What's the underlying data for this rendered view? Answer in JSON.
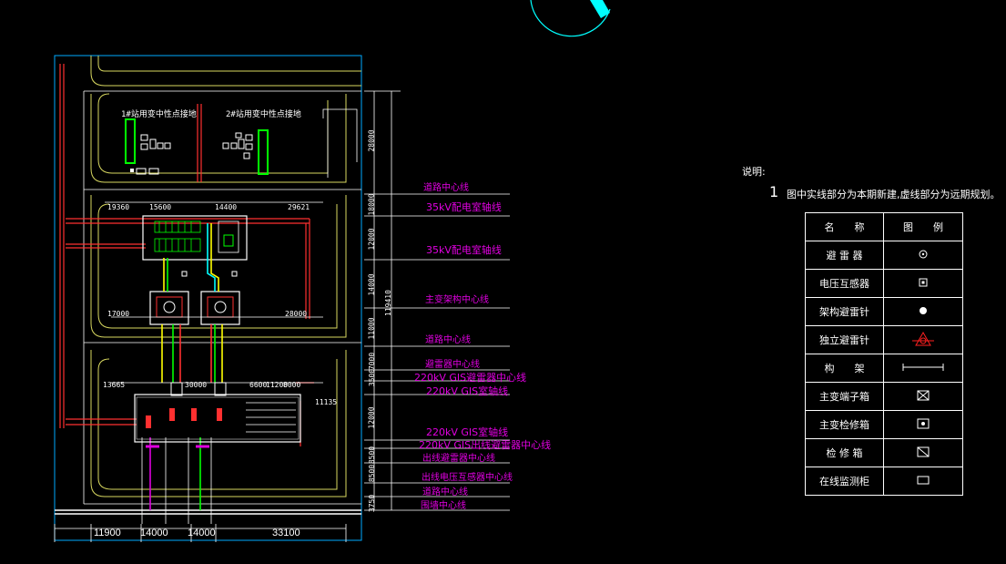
{
  "notes": {
    "title": "说明:",
    "item_number": "1",
    "item_text": "图中实线部分为本期新建,虚线部分为远期规划。"
  },
  "legend": {
    "header_name": "名　　称",
    "header_symbol": "图　　例",
    "rows": [
      {
        "name": "避 雷 器",
        "icon": "circle-dot-icon"
      },
      {
        "name": "电压互感器",
        "icon": "square-dot-icon"
      },
      {
        "name": "架构避雷针",
        "icon": "filled-circle-icon"
      },
      {
        "name": "独立避雷针",
        "icon": "triangle-circle-icon"
      },
      {
        "name": "构　　架",
        "icon": "beam-icon"
      },
      {
        "name": "主变端子箱",
        "icon": "square-x-icon"
      },
      {
        "name": "主变检修箱",
        "icon": "square-dot-filled-icon"
      },
      {
        "name": "检 修 箱",
        "icon": "square-slash-icon"
      },
      {
        "name": "在线监测柜",
        "icon": "rectangle-icon"
      }
    ]
  },
  "centerlines": [
    "道路中心线",
    "35kV配电室轴线",
    "35kV配电室轴线",
    "主变架构中心线",
    "道路中心线",
    "避雷器中心线",
    "220kV GIS避雷器中心线",
    "220kV GIS室轴线",
    "220kV GIS室轴线",
    "220kV GIS出线避雷器中心线",
    "出线避雷器中心线",
    "出线电压互感器中心线",
    "道路中心线",
    "围墙中心线"
  ],
  "bottom_dims": [
    "11900",
    "14000",
    "14000",
    "33100"
  ],
  "right_total_dim": "119410",
  "vertical_dims": [
    "28000",
    "18000",
    "12000",
    "14000",
    "11000",
    "7000",
    "3500",
    "12000",
    "8500",
    "8500",
    "3750"
  ],
  "top_dims": [
    "19360",
    "15600",
    "14400",
    "29621"
  ],
  "mid_dims": [
    "17000",
    "28000",
    "13665",
    "30000",
    "6600",
    "11200",
    "8000",
    "11135"
  ],
  "station_labels": [
    "1#站用变中性点接地",
    "2#站用变中性点接地"
  ],
  "colors": {
    "background": "#000000",
    "boundary": "#00aaff",
    "road": "#d8d860",
    "centerline_text": "#e000e0",
    "lines": "#ffffff",
    "cyan": "#00ffff",
    "green": "#00ff00",
    "red": "#ff2020",
    "yellow": "#ffff00"
  }
}
